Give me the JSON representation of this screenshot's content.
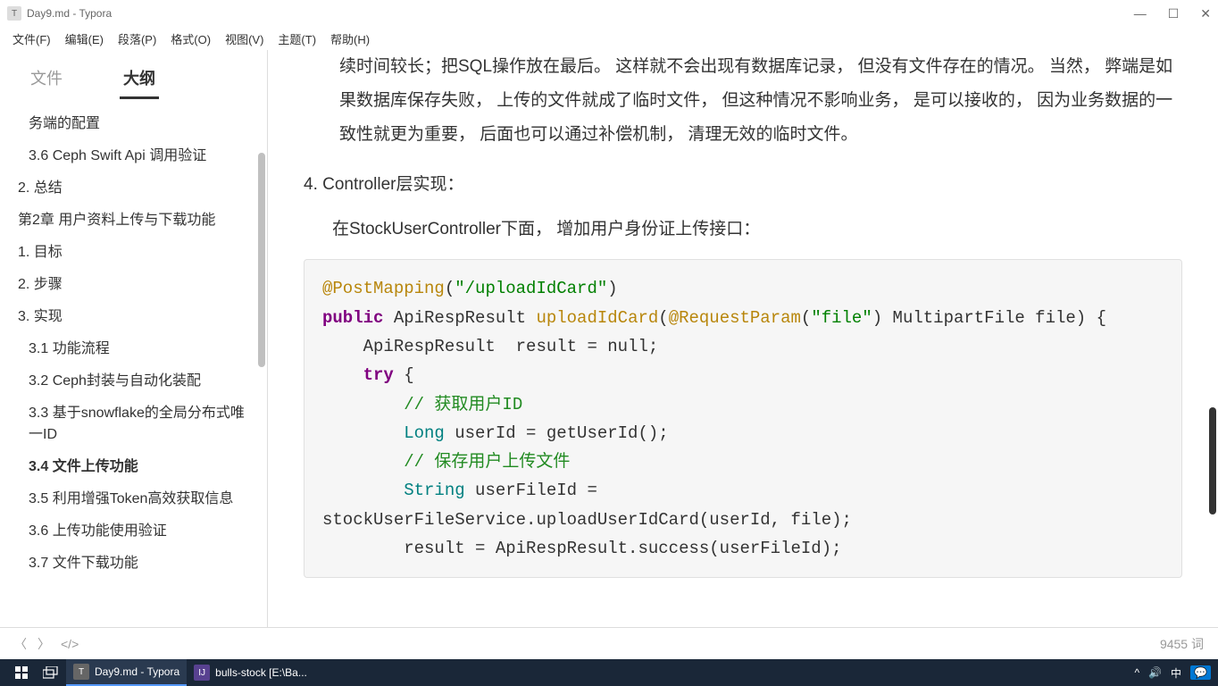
{
  "window": {
    "title": "Day9.md - Typora",
    "app_icon": "T"
  },
  "menu": {
    "file": "文件(F)",
    "edit": "编辑(E)",
    "paragraph": "段落(P)",
    "format": "格式(O)",
    "view": "视图(V)",
    "theme": "主题(T)",
    "help": "帮助(H)"
  },
  "sidebar": {
    "tabs": {
      "files": "文件",
      "outline": "大纲"
    },
    "items": [
      {
        "text": "务端的配置",
        "indent": 2
      },
      {
        "text": "3.6 Ceph Swift Api 调用验证",
        "indent": 2
      },
      {
        "text": "2. 总结",
        "indent": 1
      },
      {
        "text": "第2章 用户资料上传与下载功能",
        "indent": 1
      },
      {
        "text": "1. 目标",
        "indent": 1
      },
      {
        "text": "2. 步骤",
        "indent": 1
      },
      {
        "text": "3. 实现",
        "indent": 1
      },
      {
        "text": "3.1 功能流程",
        "indent": 2
      },
      {
        "text": "3.2 Ceph封装与自动化装配",
        "indent": 2
      },
      {
        "text": "3.3 基于snowflake的全局分布式唯一ID",
        "indent": 2
      },
      {
        "text": "3.4 文件上传功能",
        "indent": 2,
        "active": true
      },
      {
        "text": "3.5 利用增强Token高效获取信息",
        "indent": 2
      },
      {
        "text": "3.6 上传功能使用验证",
        "indent": 2
      },
      {
        "text": "3.7 文件下载功能",
        "indent": 2
      }
    ]
  },
  "content": {
    "para1": "续时间较长；把SQL操作放在最后。 这样就不会出现有数据库记录， 但没有文件存在的情况。 当然， 弊端是如果数据库保存失败， 上传的文件就成了临时文件， 但这种情况不影响业务， 是可以接收的， 因为业务数据的一致性就更为重要， 后面也可以通过补偿机制， 清理无效的临时文件。",
    "item4_num": "4.",
    "item4_text": "Controller层实现：",
    "subpara": "在StockUserController下面， 增加用户身份证上传接口：",
    "code": {
      "l1a": "@PostMapping",
      "l1b": "(",
      "l1c": "\"/uploadIdCard\"",
      "l1d": ")",
      "l2a": "public",
      "l2b": " ApiRespResult ",
      "l2c": "uploadIdCard",
      "l2d": "(",
      "l2e": "@RequestParam",
      "l2f": "(",
      "l2g": "\"file\"",
      "l2h": ") MultipartFile file) {",
      "l3": "    ApiRespResult  result = null;",
      "l4a": "    ",
      "l4b": "try",
      "l4c": " {",
      "l5": "        // 获取用户ID",
      "l6a": "        ",
      "l6b": "Long",
      "l6c": " userId = getUserId();",
      "l7": "        // 保存用户上传文件",
      "l8a": "        ",
      "l8b": "String",
      "l8c": " userFileId = ",
      "l9": "stockUserFileService.uploadUserIdCard(userId, file);",
      "l10": "        result = ApiRespResult.success(userFileId);"
    }
  },
  "statusbar": {
    "word_count": "9455 词"
  },
  "taskbar": {
    "typora": "Day9.md - Typora",
    "intellij": "bulls-stock [E:\\Ba...",
    "ime": "中",
    "notify_count": "1"
  }
}
